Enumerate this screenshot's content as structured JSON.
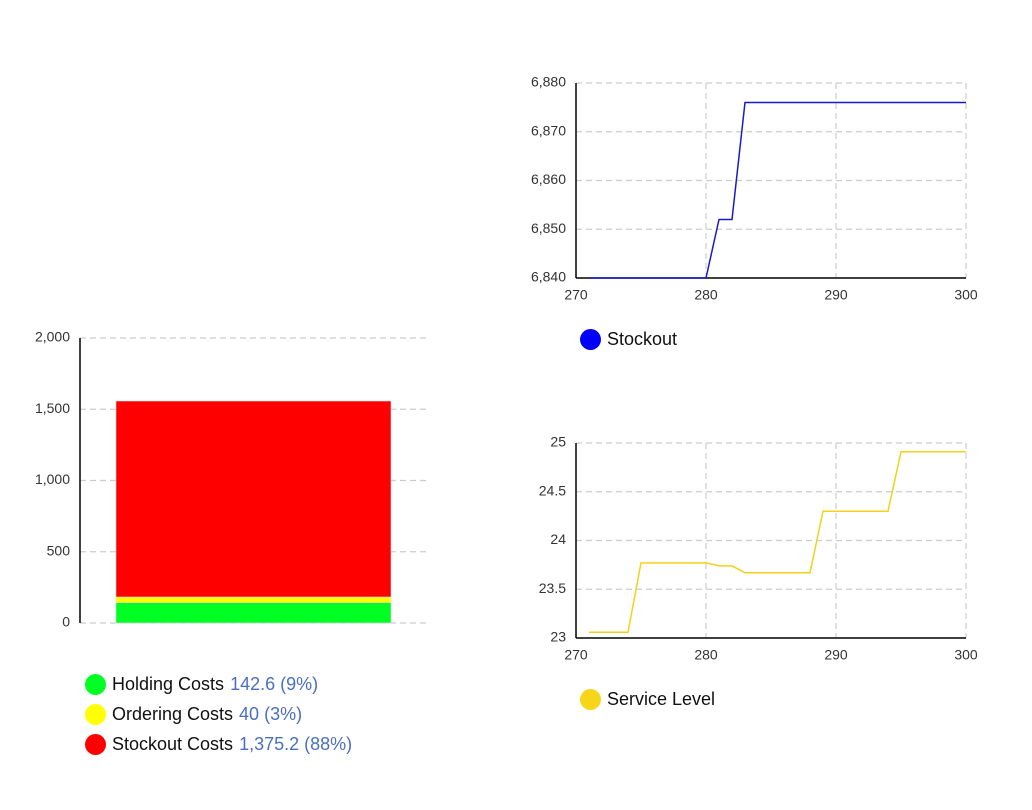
{
  "colors": {
    "holding": "#00ff22",
    "ordering": "#ffff00",
    "stockout_cost": "#ff0000",
    "stockout_line": "#1a1acc",
    "stockout_legend": "#0000ff",
    "service_line": "#f2d21a",
    "service_legend": "#f7d619"
  },
  "cost_legend": [
    {
      "label": "Holding Costs",
      "value": "142.6 (9%)"
    },
    {
      "label": "Ordering Costs",
      "value": "40 (3%)"
    },
    {
      "label": "Stockout Costs",
      "value": "1,375.2 (88%)"
    }
  ],
  "chart_data": [
    {
      "type": "bar",
      "stacked": true,
      "categories": [
        ""
      ],
      "series": [
        {
          "name": "Holding Costs",
          "values": [
            142.6
          ]
        },
        {
          "name": "Ordering Costs",
          "values": [
            40
          ]
        },
        {
          "name": "Stockout Costs",
          "values": [
            1375.2
          ]
        }
      ],
      "ylim": [
        0,
        2000
      ],
      "yticks": [
        0,
        500,
        1000,
        1500,
        2000
      ],
      "ytick_labels": [
        "0",
        "500",
        "1,000",
        "1,500",
        "2,000"
      ],
      "grid": true,
      "legend": "bottom"
    },
    {
      "type": "line",
      "series": [
        {
          "name": "Stockout",
          "x": [
            271,
            280,
            281,
            282,
            283,
            300
          ],
          "y": [
            6840,
            6840,
            6852,
            6852,
            6876,
            6876
          ]
        }
      ],
      "xlim": [
        270,
        300
      ],
      "ylim": [
        6840,
        6880
      ],
      "xticks": [
        270,
        280,
        290,
        300
      ],
      "yticks": [
        6840,
        6850,
        6860,
        6870,
        6880
      ],
      "ytick_labels": [
        "6,840",
        "6,850",
        "6,860",
        "6,870",
        "6,880"
      ],
      "grid": true,
      "legend": "bottom-left"
    },
    {
      "type": "line",
      "series": [
        {
          "name": "Service Level",
          "x": [
            271,
            274,
            275,
            280,
            281,
            282,
            283,
            288,
            289,
            294,
            295,
            300
          ],
          "y": [
            23.06,
            23.06,
            23.77,
            23.77,
            23.74,
            23.74,
            23.67,
            23.67,
            24.3,
            24.3,
            24.91,
            24.91
          ]
        }
      ],
      "xlim": [
        270,
        300
      ],
      "ylim": [
        23,
        25
      ],
      "xticks": [
        270,
        280,
        290,
        300
      ],
      "yticks": [
        23,
        23.5,
        24,
        24.5,
        25
      ],
      "ytick_labels": [
        "23",
        "23.5",
        "24",
        "24.5",
        "25"
      ],
      "grid": true,
      "legend": "bottom-left"
    }
  ]
}
